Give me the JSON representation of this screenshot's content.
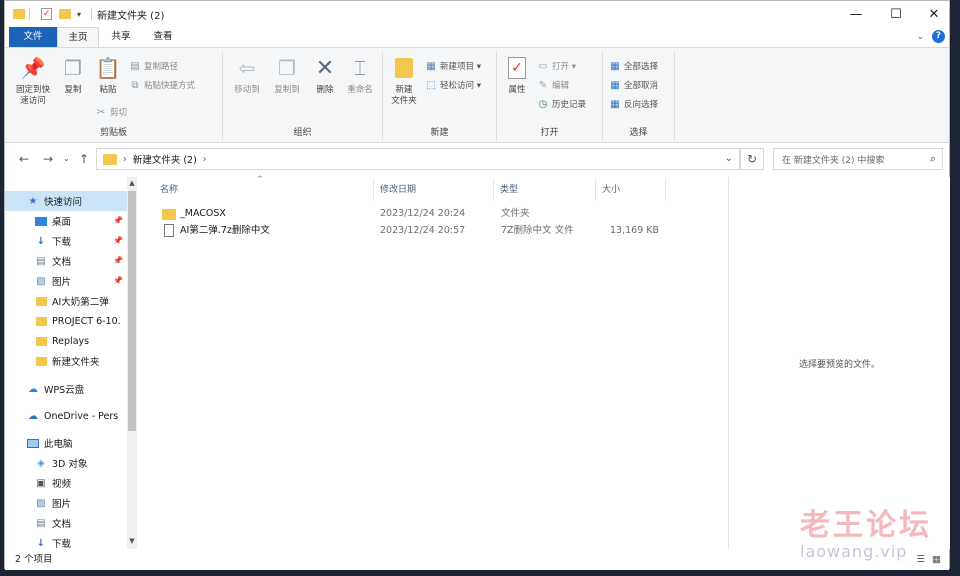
{
  "titlebar": {
    "title": "新建文件夹 (2)",
    "minimize": "—",
    "maximize": "☐",
    "close": "✕"
  },
  "tabs": {
    "file": "文件",
    "home": "主页",
    "share": "共享",
    "view": "查看"
  },
  "ribbon": {
    "clipboard": {
      "label": "剪贴板",
      "pin": "固定到快\n速访问",
      "copy": "复制",
      "paste": "粘贴",
      "copy_path": "复制路径",
      "paste_shortcut": "粘贴快捷方式",
      "cut": "剪切"
    },
    "organize": {
      "label": "组织",
      "move_to": "移动到",
      "copy_to": "复制到",
      "delete": "删除",
      "rename": "重命名"
    },
    "new": {
      "label": "新建",
      "new_folder": "新建\n文件夹",
      "new_item": "新建项目 ▾",
      "easy_access": "轻松访问 ▾"
    },
    "open": {
      "label": "打开",
      "properties": "属性",
      "open": "打开 ▾",
      "edit": "编辑",
      "history": "历史记录"
    },
    "select": {
      "label": "选择",
      "select_all": "全部选择",
      "select_none": "全部取消",
      "invert": "反向选择"
    }
  },
  "address": {
    "path": "新建文件夹 (2)",
    "search_placeholder": "在 新建文件夹 (2) 中搜索"
  },
  "nav": {
    "quick_access": "快速访问",
    "items": [
      {
        "label": "桌面",
        "icon": "desktop-icon",
        "pinned": true
      },
      {
        "label": "下载",
        "icon": "download-icon",
        "pinned": true
      },
      {
        "label": "文档",
        "icon": "document-icon",
        "pinned": true
      },
      {
        "label": "图片",
        "icon": "picture-icon",
        "pinned": true
      },
      {
        "label": "AI大奶第二弹",
        "icon": "folder-icon",
        "pinned": false
      },
      {
        "label": "PROJECT 6-10.",
        "icon": "folder-icon",
        "pinned": false
      },
      {
        "label": "Replays",
        "icon": "folder-icon",
        "pinned": false
      },
      {
        "label": "新建文件夹",
        "icon": "folder-icon",
        "pinned": false
      }
    ],
    "wps": "WPS云盘",
    "onedrive": "OneDrive - Pers",
    "this_pc": "此电脑",
    "pc_items": [
      {
        "label": "3D 对象",
        "icon": "3d-objects-icon"
      },
      {
        "label": "视频",
        "icon": "video-icon"
      },
      {
        "label": "图片",
        "icon": "picture-icon"
      },
      {
        "label": "文档",
        "icon": "document-icon"
      },
      {
        "label": "下载",
        "icon": "download-icon"
      }
    ]
  },
  "columns": {
    "name": "名称",
    "modified": "修改日期",
    "type": "类型",
    "size": "大小"
  },
  "files": [
    {
      "name": "_MACOSX",
      "modified": "2023/12/24 20:24",
      "type": "文件夹",
      "size": "",
      "icon": "folder-icon"
    },
    {
      "name": "AI第二弹.7z删除中文",
      "modified": "2023/12/24 20:57",
      "type": "7Z删除中文 文件",
      "size": "13,169 KB",
      "icon": "file-icon"
    }
  ],
  "preview": {
    "text": "选择要预览的文件。"
  },
  "status": {
    "count": "2 个项目"
  },
  "watermark": {
    "cn": "老王论坛",
    "en": "laowang.vip"
  },
  "colors": {
    "accent": "#1a63b6",
    "selection": "#cce4f7",
    "folder": "#f4c74f"
  }
}
